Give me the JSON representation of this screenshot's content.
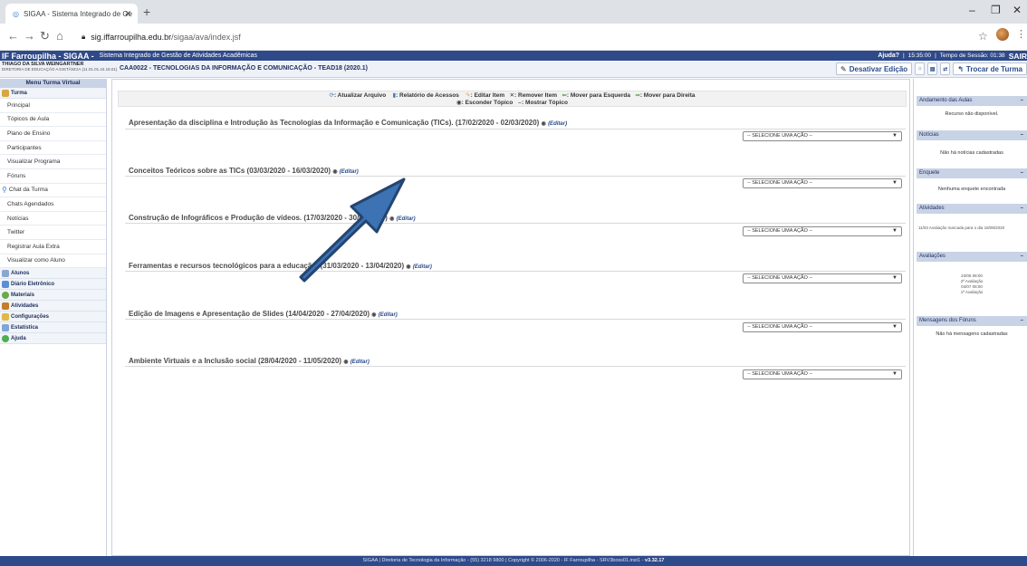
{
  "browser": {
    "tab_title": "SIGAA - Sistema Integrado de Ge",
    "url_domain": "sig.iffarroupilha.edu.br",
    "url_path": "/sigaa/ava/index.jsf"
  },
  "header": {
    "brand": "IF Farroupilha - SIGAA -",
    "system_name": "Sistema Integrado de Gestão de Atividades Acadêmicas",
    "help": "Ajuda?",
    "time": "15:35:00",
    "session_label": "Tempo de Sessão: 01:38",
    "logout": "SAIR",
    "user_name": "THIAGO DA SILVA WEINGARTNER",
    "user_unit": "DIRETORIA DE EDUCAÇÃO A DISTÂNCIA (11.01.01.44.18.01)",
    "course": "CAA0022 - TECNOLOGIAS DA INFORMAÇÃO E COMUNICAÇÃO - TEAD18 (2020.1)",
    "disable_edit": "Desativar Edição",
    "switch_class": "Trocar de Turma"
  },
  "menu": {
    "title": "Menu Turma Virtual",
    "turma": "Turma",
    "items": [
      "Principal",
      "Tópicos de Aula",
      "Plano de Ensino",
      "Participantes",
      "Visualizar Programa",
      "Fóruns"
    ],
    "chat": "Chat da Turma",
    "items2": [
      "Chats Agendados",
      "Notícias",
      "Twitter",
      "Registrar Aula Extra",
      "Visualizar como Aluno"
    ],
    "groups": [
      "Alunos",
      "Diário Eletrônico",
      "Materiais",
      "Atividades",
      "Configurações",
      "Estatística",
      "Ajuda"
    ]
  },
  "toolbar": {
    "update": ": Atualizar Arquivo",
    "report": ": Relatório de Acessos",
    "edit_item": ": Editar Item",
    "remove_item": ": Remover Item",
    "move_left": ": Mover para Esquerda",
    "move_right": ": Mover para Direita",
    "hide_topic": ": Esconder Tópico",
    "show_topic": ": Mostrar Tópico"
  },
  "topics": [
    {
      "title": "Apresentação da disciplina e Introdução às Tecnologias da Informação e Comunicação (TICs). (17/02/2020 - 02/03/2020)"
    },
    {
      "title": "Conceitos Teóricos sobre as TICs (03/03/2020 - 16/03/2020)"
    },
    {
      "title": "Construção de Infográficos e Produção de vídeos. (17/03/2020 - 30/03/2020)"
    },
    {
      "title": "Ferramentas e recursos tecnológicos para a educação. (31/03/2020 - 13/04/2020)"
    },
    {
      "title": "Edição de Imagens e Apresentação de Slides (14/04/2020 - 27/04/2020)"
    },
    {
      "title": "Ambiente Virtuais e a Inclusão social (28/04/2020 - 11/05/2020)"
    }
  ],
  "edit_label": "(Editar)",
  "select_action": "-- SELECIONE UMA AÇÃO --",
  "right": {
    "progress_title": "Andamento das Aulas",
    "progress_text": "Recurso não disponível.",
    "news_title": "Notícias",
    "news_text": "Não há notícias cadastradas",
    "poll_title": "Enquete",
    "poll_text": "Nenhuma enquete encontrada",
    "activities_title": "Atividades",
    "activities_text": "11/03 Avaliação marcada para o dia 18/08/2020",
    "evals_title": "Avaliações",
    "evals": [
      "23/05 08:00",
      "2ª Avaliação",
      "04/07 08:00",
      "1ª Avaliação"
    ],
    "forum_title": "Mensagens dos Fóruns",
    "forum_text": "Não há mensagens cadastradas"
  },
  "footer": {
    "text": "SIGAA | Diretoria de Tecnologia da Informação - (55) 3218 9800 | Copyright © 2006-2020 - IF Farroupilha - SRV3boss01.inst1 -",
    "version": "v3.32.17"
  },
  "colors": {
    "header_blue": "#2f4a8a",
    "arrow_fill": "#3d72b4",
    "arrow_stroke": "#23456f"
  }
}
